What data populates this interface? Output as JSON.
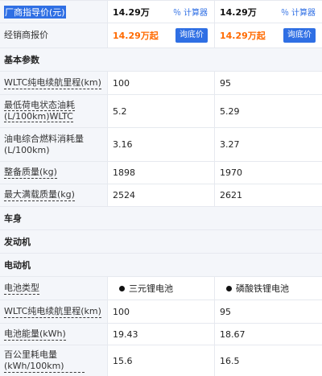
{
  "header": {
    "label": "厂商指导价(元)",
    "col1_price": "14.29万",
    "col2_price": "14.29万",
    "calc_label": "计算器",
    "calc_icon": "percent-icon"
  },
  "dealer": {
    "label": "经销商报价",
    "col1_price": "14.29万起",
    "col2_price": "14.29万起",
    "button": "询底价"
  },
  "sections": {
    "basic": "基本参数",
    "body": "车身",
    "engine": "发动机",
    "motor": "电动机"
  },
  "basic_rows": [
    {
      "label": "WLTC纯电续航里程(km)",
      "v1": "100",
      "v2": "95"
    },
    {
      "label": "最低荷电状态油耗(L/100km)WLTC",
      "v1": "5.2",
      "v2": "5.29"
    },
    {
      "label": "油电综合燃料消耗量(L/100km)",
      "v1": "3.16",
      "v2": "3.27"
    },
    {
      "label": "整备质量(kg)",
      "v1": "1898",
      "v2": "1970"
    },
    {
      "label": "最大满载质量(kg)",
      "v1": "2524",
      "v2": "2621"
    }
  ],
  "motor_rows": [
    {
      "label": "电池类型",
      "v1": "三元锂电池",
      "v2": "磷酸铁锂电池"
    },
    {
      "label": "WLTC纯电续航里程(km)",
      "v1": "100",
      "v2": "95"
    },
    {
      "label": "电池能量(kWh)",
      "v1": "19.43",
      "v2": "18.67"
    },
    {
      "label": "百公里耗电量(kWh/100km)",
      "v1": "15.6",
      "v2": "16.5"
    }
  ],
  "colors": {
    "accent": "#2f6fe4",
    "dealer_price": "#ff6a00",
    "label_bg": "#f4f6fa"
  }
}
